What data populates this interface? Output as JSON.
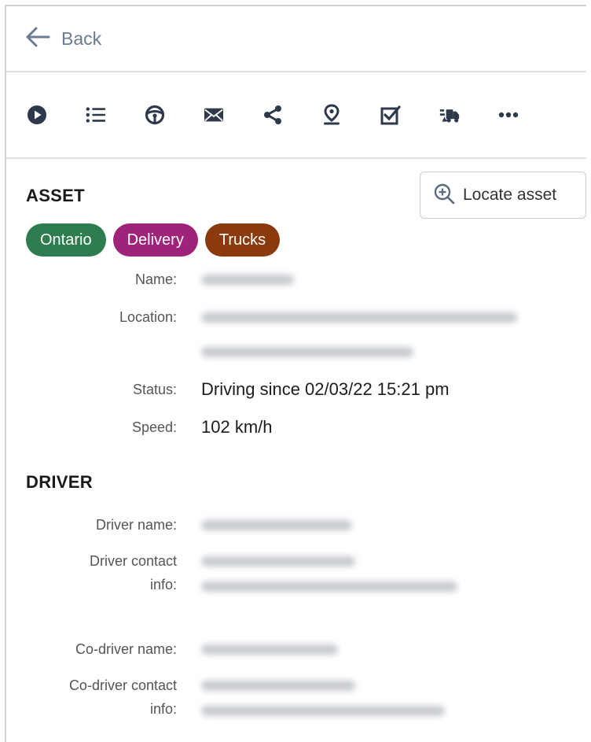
{
  "nav": {
    "back_label": "Back"
  },
  "toolbar": {
    "icons": [
      "play-circle-icon",
      "list-icon",
      "steering-wheel-icon",
      "mail-icon",
      "share-icon",
      "map-pin-icon",
      "checklist-icon",
      "truck-icon",
      "more-icon"
    ]
  },
  "asset": {
    "title": "ASSET",
    "locate_label": "Locate asset",
    "chips": [
      {
        "label": "Ontario",
        "color": "#2e7d4f"
      },
      {
        "label": "Delivery",
        "color": "#a0237a"
      },
      {
        "label": "Trucks",
        "color": "#8a3a0c"
      }
    ],
    "name_label": "Name:",
    "location_label": "Location:",
    "status_label": "Status:",
    "status_value": "Driving since 02/03/22 15:21 pm",
    "speed_label": "Speed:",
    "speed_value": "102 km/h"
  },
  "driver": {
    "title": "DRIVER",
    "driver_name_label": "Driver name:",
    "driver_contact_label_1": "Driver contact",
    "driver_contact_label_2": "info:",
    "codriver_name_label": "Co-driver name:",
    "codriver_contact_label_1": "Co-driver contact",
    "codriver_contact_label_2": "info:"
  }
}
